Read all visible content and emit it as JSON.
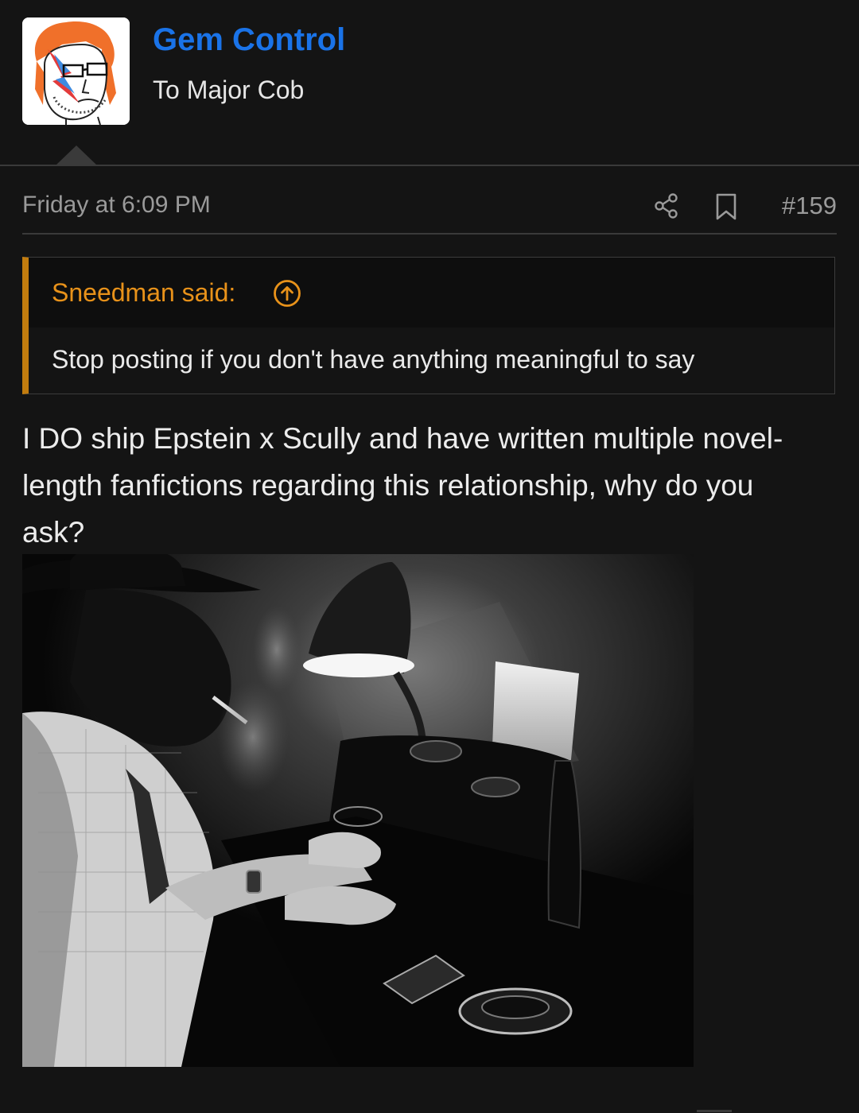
{
  "user": {
    "name": "Gem Control",
    "title": "To Major Cob",
    "name_color": "#1a73e8",
    "avatar_icon": "avatar-image"
  },
  "message": {
    "date": "Friday at 6:09 PM",
    "share_icon": "share-icon",
    "bookmark_icon": "bookmark-icon",
    "number": "#159"
  },
  "quote": {
    "author": "Sneedman said:",
    "jump_icon": "arrow-up-circle-icon",
    "text": "Stop posting if you don't have anything meaningful to say",
    "accent_color": "#c27c0e"
  },
  "body": {
    "text": "I DO ship Epstein x Scully and have written multiple novel-length fanfictions regarding this relationship, why do you ask?"
  },
  "colors": {
    "background": "#141414",
    "muted_text": "#9a9a9a",
    "quote_author": "#e8921a"
  }
}
